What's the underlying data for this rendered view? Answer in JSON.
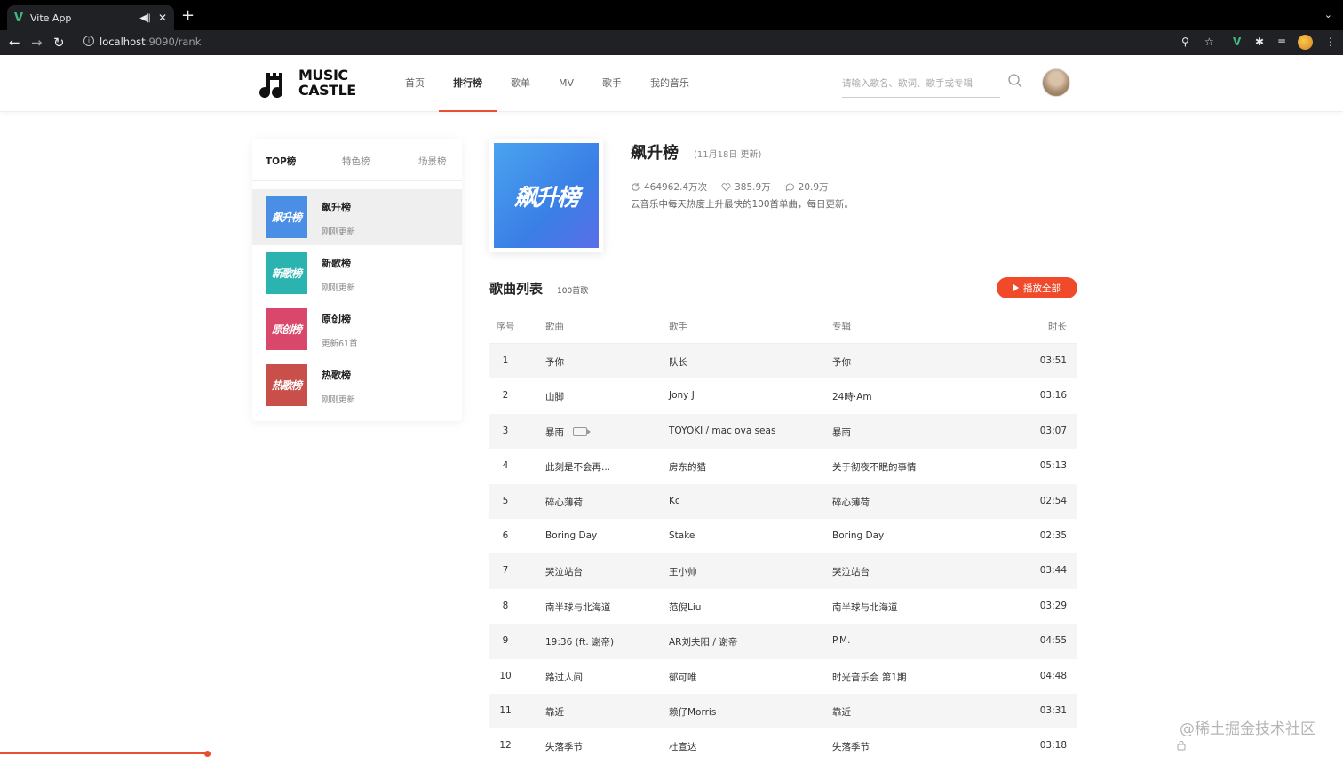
{
  "browser": {
    "tab_title": "Vite App",
    "favicon": "V",
    "url_host": "localhost",
    "url_path": ":9090/rank"
  },
  "site": {
    "logo_line1": "MUSIC",
    "logo_line2": "CASTLE",
    "nav": [
      "首页",
      "排行榜",
      "歌单",
      "MV",
      "歌手",
      "我的音乐"
    ],
    "nav_active_index": 1,
    "search_placeholder": "请输入歌名、歌词、歌手或专辑"
  },
  "rank_panel": {
    "tabs": [
      "TOP榜",
      "特色榜",
      "场景榜"
    ],
    "active_tab": 0,
    "items": [
      {
        "name": "飙升榜",
        "sub": "刚刚更新",
        "cover_text": "飙升榜",
        "cover_color": "#4a8ee6"
      },
      {
        "name": "新歌榜",
        "sub": "刚刚更新",
        "cover_text": "新歌榜",
        "cover_color": "#2bb3b0"
      },
      {
        "name": "原创榜",
        "sub": "更新61首",
        "cover_text": "原创榜",
        "cover_color": "#d9486a"
      },
      {
        "name": "热歌榜",
        "sub": "刚刚更新",
        "cover_text": "热歌榜",
        "cover_color": "#c9504a"
      }
    ]
  },
  "detail": {
    "cover_text": "飙升榜",
    "title": "飙升榜",
    "update": "(11月18日 更新)",
    "plays": "464962.4万次",
    "likes": "385.9万",
    "comments": "20.9万",
    "description": "云音乐中每天热度上升最快的100首单曲，每日更新。"
  },
  "song_list": {
    "title": "歌曲列表",
    "count": "100首歌",
    "play_all": "播放全部",
    "headers": {
      "index": "序号",
      "song": "歌曲",
      "artist": "歌手",
      "album": "专辑",
      "duration": "时长"
    },
    "rows": [
      {
        "index": "1",
        "song": "予你",
        "artist": "队长",
        "album": "予你",
        "duration": "03:51"
      },
      {
        "index": "2",
        "song": "山脚",
        "artist": "Jony J",
        "album": "24時·Am",
        "duration": "03:16"
      },
      {
        "index": "3",
        "song": "暴雨",
        "artist": "TOYOKI / mac ova seas",
        "album": "暴雨",
        "duration": "03:07",
        "mv": true
      },
      {
        "index": "4",
        "song": "此刻是不会再...",
        "artist": "房东的猫",
        "album": "关于彻夜不眠的事情",
        "duration": "05:13"
      },
      {
        "index": "5",
        "song": "碎心薄荷",
        "artist": "Kc",
        "album": "碎心薄荷",
        "duration": "02:54"
      },
      {
        "index": "6",
        "song": "Boring Day",
        "artist": "Stake",
        "album": "Boring Day",
        "duration": "02:35"
      },
      {
        "index": "7",
        "song": "哭泣站台",
        "artist": "王小帅",
        "album": "哭泣站台",
        "duration": "03:44"
      },
      {
        "index": "8",
        "song": "南半球与北海道",
        "artist": "范倪Liu",
        "album": "南半球与北海道",
        "duration": "03:29"
      },
      {
        "index": "9",
        "song": "19:36 (ft. 谢帝)",
        "artist": "AR刘夫阳 / 谢帝",
        "album": "P.M.",
        "duration": "04:55"
      },
      {
        "index": "10",
        "song": "路过人间",
        "artist": "郁可唯",
        "album": "时光音乐会 第1期",
        "duration": "04:48"
      },
      {
        "index": "11",
        "song": "靠近",
        "artist": "赖仔Morris",
        "album": "靠近",
        "duration": "03:31"
      },
      {
        "index": "12",
        "song": "失落季节",
        "artist": "杜宣达",
        "album": "失落季节",
        "duration": "03:18"
      }
    ]
  },
  "watermark": "@稀土掘金技术社区",
  "colors": {
    "accent": "#e84f30",
    "play_all": "#f04a2a"
  }
}
